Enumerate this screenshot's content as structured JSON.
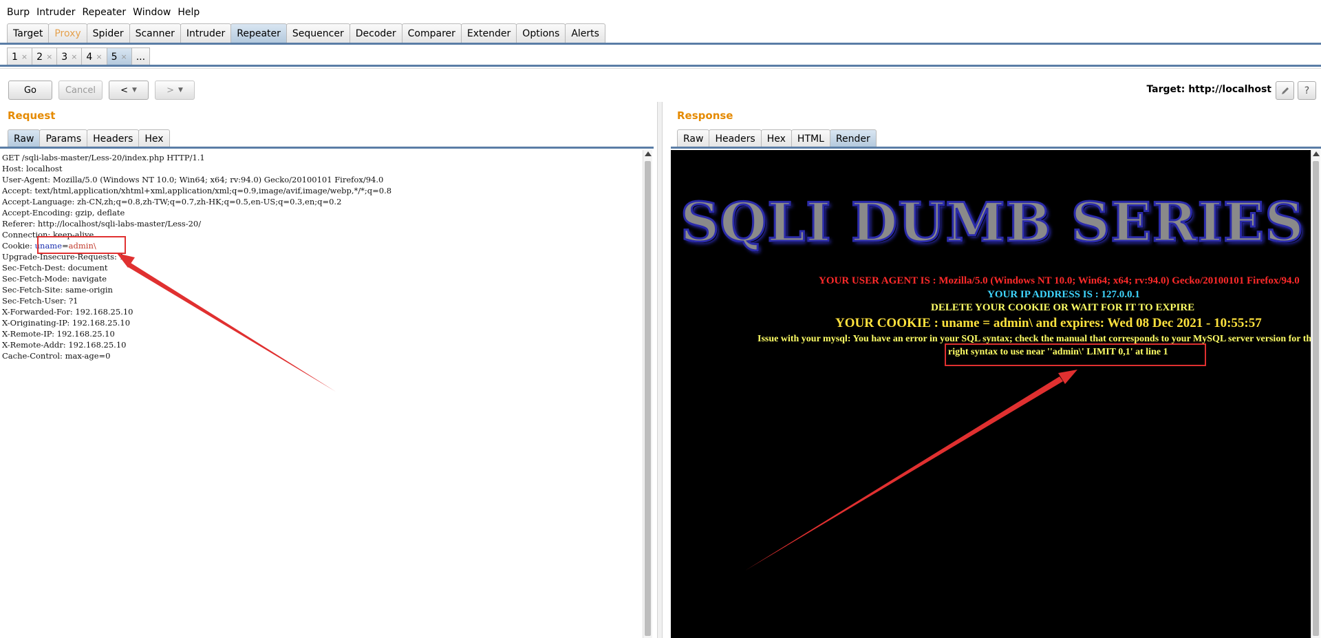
{
  "menu": {
    "items": [
      "Burp",
      "Intruder",
      "Repeater",
      "Window",
      "Help"
    ]
  },
  "main_tabs": [
    "Target",
    "Proxy",
    "Spider",
    "Scanner",
    "Intruder",
    "Repeater",
    "Sequencer",
    "Decoder",
    "Comparer",
    "Extender",
    "Options",
    "Alerts"
  ],
  "repeater_tabs": [
    "1",
    "2",
    "3",
    "4",
    "5",
    "..."
  ],
  "toolbar": {
    "go": "Go",
    "cancel": "Cancel",
    "back": "<",
    "forward": ">",
    "target_label": "Target: http://localhost",
    "help": "?"
  },
  "request": {
    "title": "Request",
    "tabs": [
      "Raw",
      "Params",
      "Headers",
      "Hex"
    ],
    "lines": [
      "GET /sqli-labs-master/Less-20/index.php HTTP/1.1",
      "Host: localhost",
      "User-Agent: Mozilla/5.0 (Windows NT 10.0; Win64; x64; rv:94.0) Gecko/20100101 Firefox/94.0",
      "Accept: text/html,application/xhtml+xml,application/xml;q=0.9,image/avif,image/webp,*/*;q=0.8",
      "Accept-Language: zh-CN,zh;q=0.8,zh-TW;q=0.7,zh-HK;q=0.5,en-US;q=0.3,en;q=0.2",
      "Accept-Encoding: gzip, deflate",
      "Referer: http://localhost/sqli-labs-master/Less-20/",
      "Connection: keep-alive",
      "Upgrade-Insecure-Requests: 1",
      "Sec-Fetch-Dest: document",
      "Sec-Fetch-Mode: navigate",
      "Sec-Fetch-Site: same-origin",
      "Sec-Fetch-User: ?1",
      "X-Forwarded-For: 192.168.25.10",
      "X-Originating-IP: 192.168.25.10",
      "X-Remote-IP: 192.168.25.10",
      "X-Remote-Addr: 192.168.25.10",
      "Cache-Control: max-age=0"
    ],
    "cookie_prefix": "Cookie: ",
    "cookie_key": "uname",
    "cookie_eq": "=",
    "cookie_val": "admin\\"
  },
  "response": {
    "title": "Response",
    "tabs": [
      "Raw",
      "Headers",
      "Hex",
      "HTML",
      "Render"
    ],
    "banner": "SQLI DUMB SERIES",
    "user_agent": "YOUR USER AGENT IS : Mozilla/5.0 (Windows NT 10.0; Win64; x64; rv:94.0) Gecko/20100101 Firefox/94.0",
    "ip": "YOUR IP ADDRESS IS : 127.0.0.1",
    "delete_cookie": "DELETE YOUR COOKIE OR WAIT FOR IT TO EXPIRE",
    "cookie_info": "YOUR COOKIE : uname = admin\\ and expires: Wed 08 Dec 2021 - 10:55:57",
    "error_line1": "Issue with your mysql: You have an error in your SQL syntax; check the manual that corresponds to your MySQL server version for the",
    "error_line2": "right syntax to use near ''admin\\' LIMIT 0,1' at line 1"
  },
  "colors": {
    "accent_orange": "#e58a00",
    "tab_active": "#b3c8dc",
    "ua_red": "#ff2a2a",
    "ip_cyan": "#3fd6ff",
    "delete_yellow": "#ffff66",
    "cookie_yellow": "#ffe23d",
    "error_yellow": "#ffff66",
    "annotation_red": "#e03030"
  }
}
